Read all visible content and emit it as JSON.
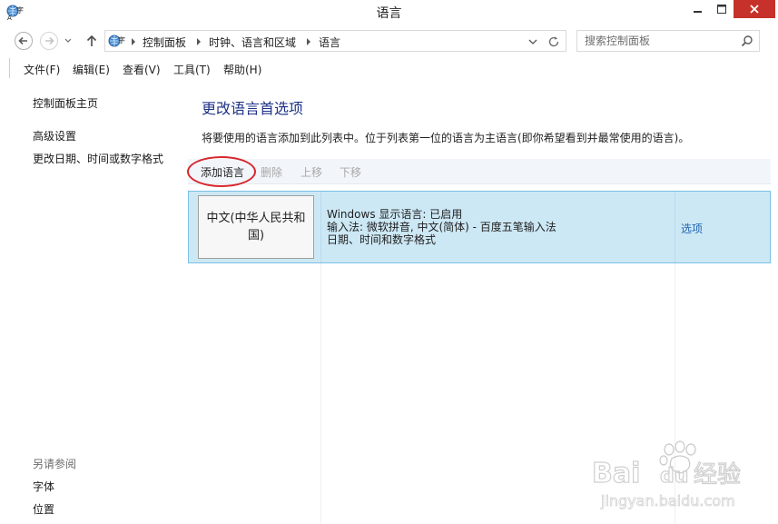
{
  "window": {
    "title": "语言",
    "buttons": {
      "minimize": "minimize-icon",
      "maximize": "maximize-icon",
      "close": "close-icon"
    }
  },
  "addressbar": {
    "breadcrumbs": [
      "控制面板",
      "时钟、语言和区域",
      "语言"
    ],
    "search_placeholder": "搜索控制面板"
  },
  "menu": [
    "文件(F)",
    "编辑(E)",
    "查看(V)",
    "工具(T)",
    "帮助(H)"
  ],
  "sidebar": {
    "links": [
      "控制面板主页",
      "高级设置",
      "更改日期、时间或数字格式"
    ],
    "see_also": {
      "title": "另请参阅",
      "links": [
        "字体",
        "位置"
      ]
    }
  },
  "main": {
    "title": "更改语言首选项",
    "description": "将要使用的语言添加到此列表中。位于列表第一位的语言为主语言(即你希望看到并最常使用的语言)。",
    "toolbar": {
      "add": "添加语言",
      "remove": "删除",
      "up": "上移",
      "down": "下移"
    },
    "languages": [
      {
        "name": "中文(中华人民共和国)",
        "details": [
          "Windows 显示语言: 已启用",
          "输入法: 微软拼音, 中文(简体) - 百度五笔输入法",
          "日期、时间和数字格式"
        ],
        "options_label": "选项"
      }
    ]
  },
  "watermark": {
    "brand": "Bai",
    "brand2": "du",
    "cn": "经验",
    "url": "jingyan.baidu.com"
  },
  "colors": {
    "title_blue": "#1e3287",
    "link_blue": "#1e64b4",
    "row_bg": "#cde8f5",
    "row_border": "#7ac0e4",
    "close_red": "#c7312b",
    "highlight_red": "#d8262c"
  }
}
